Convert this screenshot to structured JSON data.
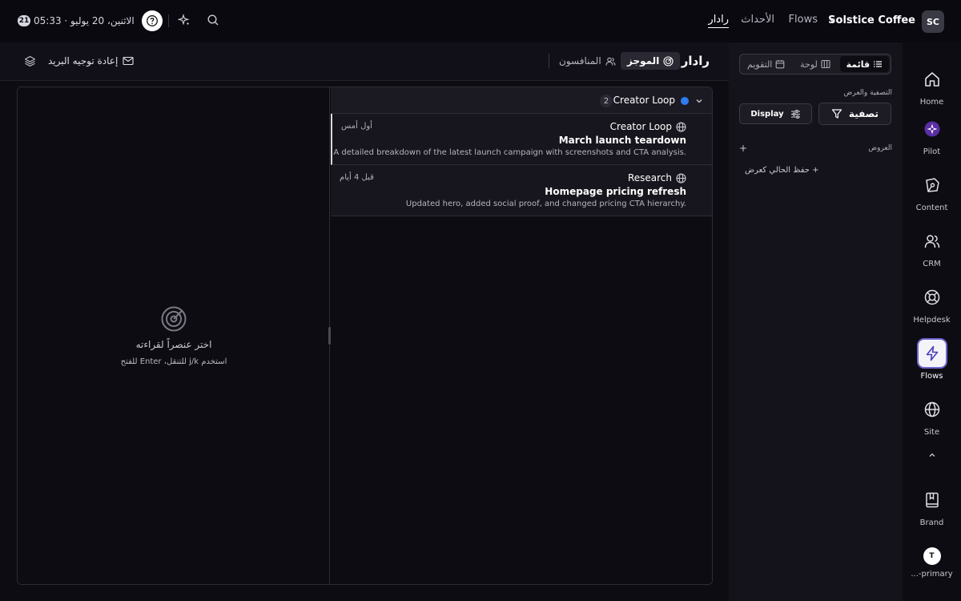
{
  "topbar": {
    "org_initials": "SC",
    "org_name": "Solstice Coffee",
    "nav": [
      {
        "label": "Flows"
      },
      {
        "label": "الأحداث"
      },
      {
        "label": "رادار"
      }
    ],
    "datetime": "الاثنين، 20 يوليو · 05:33",
    "day_badge": "21"
  },
  "rail": {
    "items": [
      {
        "label": "Home",
        "icon": "home-icon"
      },
      {
        "label": "Pilot",
        "icon": "pilot-icon"
      },
      {
        "label": "Content",
        "icon": "pen-icon"
      },
      {
        "label": "CRM",
        "icon": "users-icon"
      },
      {
        "label": "Helpdesk",
        "icon": "lifebuoy-icon"
      },
      {
        "label": "Flows",
        "icon": "bolt-icon"
      },
      {
        "label": "Site",
        "icon": "globe-icon"
      },
      {
        "label": "Brand",
        "icon": "book-icon"
      },
      {
        "label": "...-primary",
        "icon": "t-avatar",
        "initial": "T"
      }
    ],
    "active": "Flows"
  },
  "filter_panel": {
    "view_tabs": [
      {
        "label": "قائمة"
      },
      {
        "label": "لوحة"
      },
      {
        "label": "التقويم"
      }
    ],
    "filter_section_title": "التصفية والعرض",
    "filter_label": "تصفية",
    "display_label": "Display",
    "views_title": "العروض",
    "add_symbol": "+",
    "save_view_label": "+ حفظ الحالي كعرض"
  },
  "main": {
    "title": "رادار",
    "tabs": [
      {
        "label": "الموجز"
      },
      {
        "label": "المنافسون"
      }
    ],
    "forward_label": "إعادة توجيه البريد",
    "preview": {
      "title": "اختر عنصراً لقراءته",
      "subtitle": "استخدم j/k للتنقل، Enter للفتح"
    },
    "group": {
      "name": "Creator Loop",
      "count": "2",
      "color": "#2f7bf0"
    },
    "items": [
      {
        "source": "Creator Loop",
        "time": "أول أمس",
        "title": "March launch teardown",
        "description": "A detailed breakdown of the latest launch campaign with screenshots and CTA analysis."
      },
      {
        "source": "Research",
        "time": "قبل 4 أيام",
        "title": "Homepage pricing refresh",
        "description": "Updated hero, added social proof, and changed pricing CTA hierarchy."
      }
    ]
  }
}
